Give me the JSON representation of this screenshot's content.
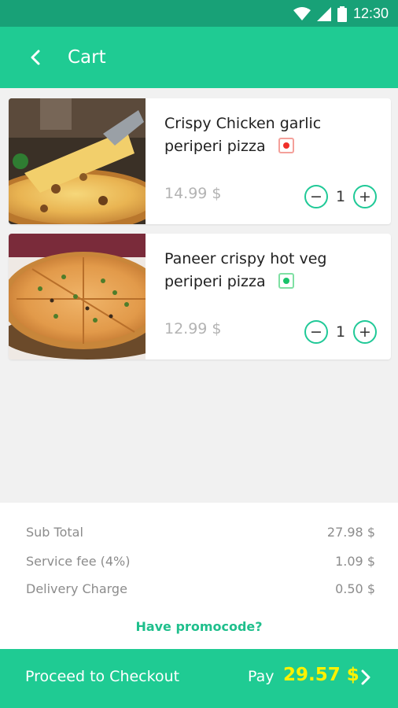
{
  "status_bar": {
    "time": "12:30"
  },
  "header": {
    "title": "Cart"
  },
  "items": [
    {
      "name": "Crispy Chicken garlic periperi pizza",
      "veg": false,
      "price": "14.99 $",
      "quantity": "1",
      "decrement": "−",
      "increment": "+"
    },
    {
      "name": "Paneer crispy hot veg periperi pizza",
      "veg": true,
      "price": "12.99 $",
      "quantity": "1",
      "decrement": "−",
      "increment": "+"
    }
  ],
  "summary": {
    "subtotal_label": "Sub Total",
    "subtotal_value": "27.98 $",
    "service_label": "Service fee (4%)",
    "service_value": "1.09 $",
    "delivery_label": "Delivery Charge",
    "delivery_value": "0.50 $",
    "promo_label": "Have promocode?"
  },
  "checkout": {
    "label": "Proceed to Checkout",
    "pay_label": "Pay",
    "amount": "29.57 $"
  },
  "colors": {
    "primary": "#1fcb93",
    "status_bar": "#18a177",
    "amount": "#fff200",
    "nonveg": "#f0302a",
    "veg": "#19c36a"
  },
  "icons": {
    "back": "chevron-left-icon",
    "checkout_arrow": "chevron-right-icon",
    "signal": "signal-icon",
    "wifi": "wifi-icon",
    "battery": "battery-icon"
  }
}
